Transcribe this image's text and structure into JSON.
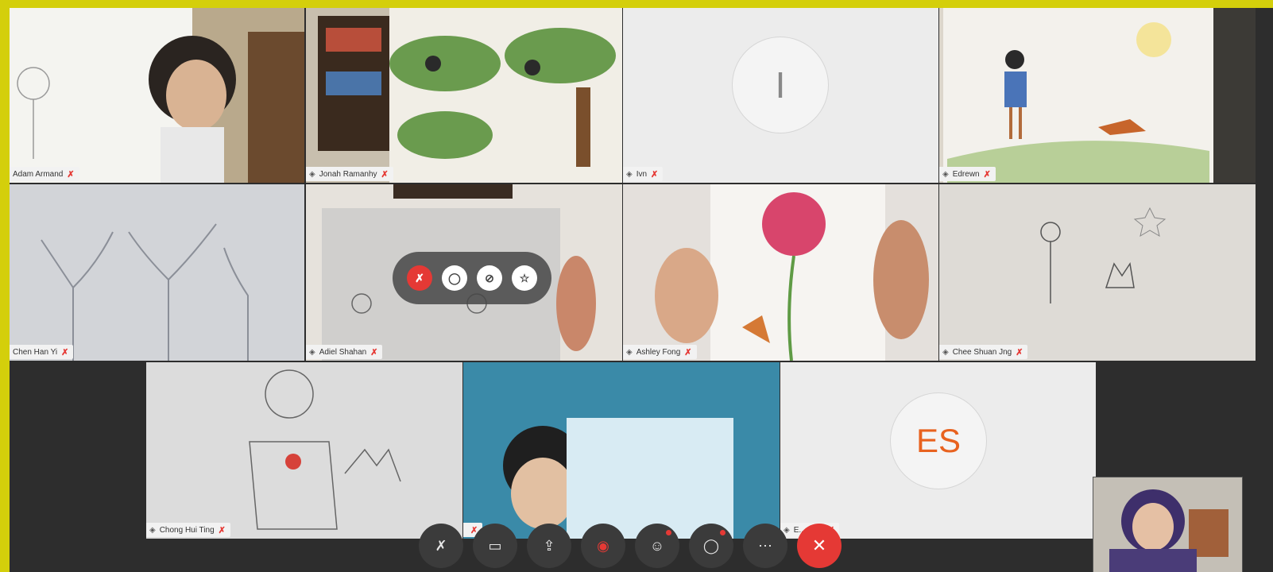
{
  "participants": [
    {
      "name": "Adam Armand",
      "muted_icon": "mic-off-icon"
    },
    {
      "name": "Jonah Ramanhy",
      "muted_icon": "mic-off-icon"
    },
    {
      "name": "Ivn",
      "initials": "I",
      "muted_icon": "mic-off-icon"
    },
    {
      "name": "Edrewn",
      "muted_icon": "mic-off-icon"
    },
    {
      "name": "Chen Han Yi",
      "muted_icon": "mic-off-icon"
    },
    {
      "name": "Adiel Shahan",
      "muted_icon": "mic-off-icon"
    },
    {
      "name": "Ashley Fong",
      "muted_icon": "mic-off-icon"
    },
    {
      "name": "Chee Shuan Jng",
      "muted_icon": "mic-off-icon"
    },
    {
      "name": "Chong Hui Ting",
      "muted_icon": "mic-off-icon"
    },
    {
      "name": "",
      "muted_icon": "mic-off-icon"
    },
    {
      "name": "E... ...ah",
      "initials": "ES",
      "muted_icon": "mic-off-icon"
    }
  ],
  "hover_controls": [
    "mic-off-icon",
    "pin-icon",
    "block-icon",
    "star-icon"
  ],
  "toolbar": [
    "mic-off-icon",
    "camera-off-icon",
    "share-screen-icon",
    "record-icon",
    "participants-icon",
    "chat-icon",
    "more-icon",
    "end-call-icon"
  ],
  "colors": {
    "accent_red": "#e53935",
    "frame_yellow": "#d4cf0b",
    "initials_orange": "#e8621f"
  }
}
